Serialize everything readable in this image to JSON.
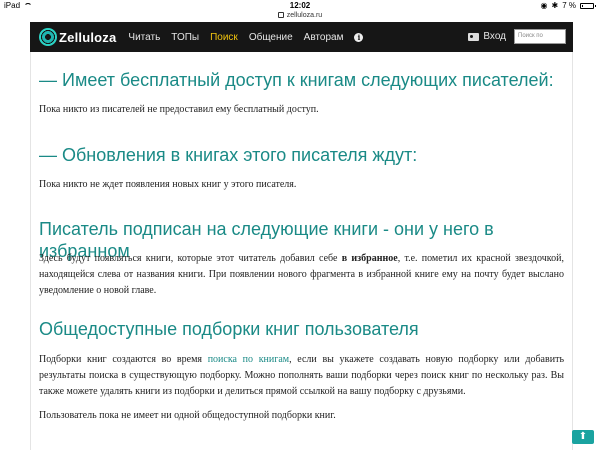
{
  "status_bar": {
    "device": "iPad",
    "time": "12:02",
    "battery": "7 %",
    "battery_level": 0.07
  },
  "url_bar": {
    "url": "zelluloza.ru"
  },
  "header": {
    "logo_text": "Zelluloza",
    "nav": [
      "Читать",
      "ТОПы",
      "Поиск",
      "Общение",
      "Авторам"
    ],
    "active_nav": "Поиск",
    "login_label": "Вход",
    "search_placeholder": "Поиск по"
  },
  "sections": {
    "free_access_title": "— Имеет бесплатный доступ к книгам следующих писателей:",
    "free_access_text": "Пока никто из писателей не предоставил ему бесплатный доступ.",
    "updates_title": "— Обновления в книгах этого писателя ждут:",
    "updates_text": "Пока никто не ждет появления новых книг у этого писателя.",
    "subscribed_title": "Писатель подписан на следующие книги - они у него в избранном",
    "subscribed_text_1": "Здесь будут появляться книги, которые этот читатель добавил себе ",
    "subscribed_text_bold": "в избранное",
    "subscribed_text_2": ", т.е. пометил их красной звездочкой, находящейся слева от названия книги. При появлении нового фрагмента в избранной книге ему на почту будет выслано уведомление о новой главе.",
    "collections_title": "Общедоступные подборки книг пользователя",
    "collections_text_1": "Подборки книг создаются во время ",
    "collections_link": "поиска по книгам",
    "collections_text_2": ", если вы укажете создавать новую подборку или добавить результаты поиска в существующую подборку. Можно пополнять ваши подборки через поиск книг по нескольку раз. Вы также можете удалять книги из подборки и делиться прямой ссылкой на вашу подборку с друзьями.",
    "collections_none": "Пользователь пока не имеет ни одной общедоступной подборки книг."
  }
}
